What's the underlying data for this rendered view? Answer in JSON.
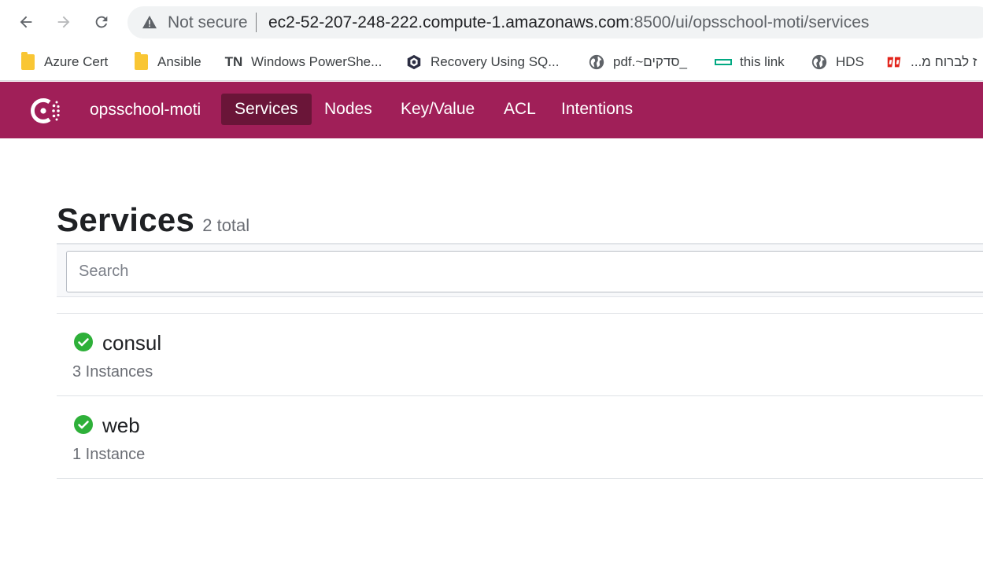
{
  "browser": {
    "security_label": "Not secure",
    "url_host": "ec2-52-207-248-222.compute-1.amazonaws.com",
    "url_path": ":8500/ui/opsschool-moti/services",
    "bookmarks": [
      {
        "label": "Azure Cert",
        "icon": "folder-icon"
      },
      {
        "label": "Ansible",
        "icon": "folder-icon"
      },
      {
        "label": "Windows PowerShe...",
        "icon": "tn-icon",
        "icon_text": "TN"
      },
      {
        "label": "Recovery Using SQ...",
        "icon": "cube-icon"
      },
      {
        "label": "pdf.~סדקים_",
        "icon": "globe-icon"
      },
      {
        "label": "this link",
        "icon": "hpe-icon"
      },
      {
        "label": "HDS",
        "icon": "globe-icon"
      },
      {
        "label": "...ז לברוח מ",
        "icon": "red-logo-icon"
      }
    ]
  },
  "app": {
    "brand_color": "#a01f58",
    "datacenter": "opsschool-moti",
    "nav": [
      {
        "label": "Services",
        "active": true
      },
      {
        "label": "Nodes",
        "active": false
      },
      {
        "label": "Key/Value",
        "active": false
      },
      {
        "label": "ACL",
        "active": false
      },
      {
        "label": "Intentions",
        "active": false
      }
    ]
  },
  "page": {
    "title": "Services",
    "count": "2 total",
    "search_placeholder": "Search"
  },
  "services": [
    {
      "name": "consul",
      "instances": "3 Instances",
      "status": "passing"
    },
    {
      "name": "web",
      "instances": "1 Instance",
      "status": "passing"
    }
  ],
  "colors": {
    "passing": "#2eb039"
  }
}
